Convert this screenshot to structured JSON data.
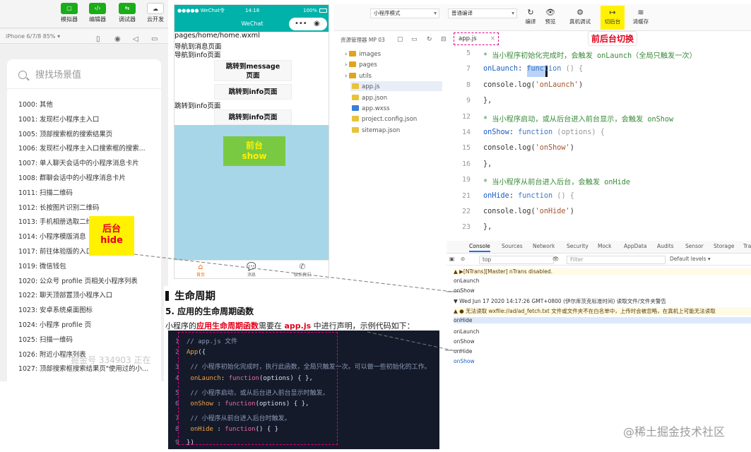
{
  "left": {
    "toolbar": [
      {
        "label": "模拟器",
        "glyph": "▢"
      },
      {
        "label": "编辑器",
        "glyph": "‹/›"
      },
      {
        "label": "调试器",
        "glyph": "⇆"
      },
      {
        "label": "云开发",
        "glyph": "☁"
      }
    ],
    "device": "iPhone 6/7/8 85% ▾",
    "search_placeholder": "搜找场景值",
    "scenes": [
      "1000: 其他",
      "1001: 发现栏小程序主入口",
      "1005: 顶部搜索框的搜索结果页",
      "1006: 发现栏小程序主入口搜索框的搜索...",
      "1007: 单人聊天会话中的小程序消息卡片",
      "1008: 群聊会话中的小程序消息卡片",
      "1011: 扫描二维码",
      "1012: 长按图片识别二维码",
      "1013: 手机相册选取二维码",
      "1014: 小程序模版消息",
      "1017: 前往体验版的入口页",
      "1019: 微信钱包",
      "1020: 公众号 profile 页相关小程序列表",
      "1022: 聊天顶部置顶小程序入口",
      "1023: 安卓系统桌面图标",
      "1024: 小程序 profile 页",
      "1025: 扫描一维码",
      "1026: 附近小程序列表",
      "1027: 顶部搜索框搜索结果页\"使用过的小..."
    ],
    "hide_badge": {
      "line1": "后台",
      "line2": "hide"
    },
    "watermark": "掘金号 334903 正在"
  },
  "phone": {
    "status_left": "●●●●● WeChat令",
    "status_time": "14:18",
    "status_right": "100%",
    "nav_title": "WeChat",
    "capsule_dots": "•••",
    "capsule_target": "◉",
    "path": "pages/home/home.wxml",
    "link1": "导航到消息页面",
    "link2": "导航到info页面",
    "btn_message": "跳转到message页面",
    "btn_info1": "跳转到info页面",
    "link3": "跳转到info页面",
    "btn_info2": "跳转到info页面",
    "show_badge": {
      "line1": "前台",
      "line2": "show"
    },
    "tabs": [
      {
        "label": "首页",
        "glyph": "⌂"
      },
      {
        "label": "消息",
        "glyph": "💬"
      },
      {
        "label": "联系我们",
        "glyph": "✆"
      }
    ]
  },
  "ide": {
    "mode_select": "小程序模式",
    "compile_select": "普通编译",
    "tools": [
      {
        "label": "编译",
        "glyph": "↻"
      },
      {
        "label": "预览",
        "glyph": "👁"
      },
      {
        "label": "真机调试",
        "glyph": "⚙"
      },
      {
        "label": "切后台",
        "glyph": "↦"
      },
      {
        "label": "清缓存",
        "glyph": "≋"
      }
    ],
    "explorer_title": "资源管理器  MP 03",
    "tree": [
      {
        "name": "images",
        "kind": "folder"
      },
      {
        "name": "pages",
        "kind": "folder"
      },
      {
        "name": "utils",
        "kind": "folder"
      },
      {
        "name": "app.js",
        "kind": "js"
      },
      {
        "name": "app.json",
        "kind": "json"
      },
      {
        "name": "app.wxss",
        "kind": "wxss"
      },
      {
        "name": "project.config.json",
        "kind": "json"
      },
      {
        "name": "sitemap.json",
        "kind": "json"
      }
    ],
    "editor_tab": "app.js",
    "switch_label": "前后台切换",
    "code_lines": [
      {
        "n": "5",
        "comment": " * 当小程序初始化完成时，会触发 onLaunch（全局只触发一次）"
      },
      {
        "n": "7",
        "fn": "onLaunch",
        "mid": ": ",
        "kw": "function",
        "rest": " () {"
      },
      {
        "n": "8",
        "plain": "  console.log(",
        "str": "'onLaunch'",
        "tail": ")"
      },
      {
        "n": "9",
        "plain": "},"
      },
      {
        "n": "12",
        "comment": " * 当小程序启动，或从后台进入前台显示，会触发 onShow"
      },
      {
        "n": "14",
        "fn": "onShow",
        "mid": ": ",
        "kw": "function",
        "rest": " (options) {"
      },
      {
        "n": "15",
        "plain": "  console.log(",
        "str": "'onShow'",
        "tail": ")"
      },
      {
        "n": "16",
        "plain": "},"
      },
      {
        "n": "19",
        "comment": " * 当小程序从前台进入后台，会触发 onHide"
      },
      {
        "n": "21",
        "fn": "onHide",
        "mid": ": ",
        "kw": "function",
        "rest": " () {"
      },
      {
        "n": "22",
        "plain": "  console.log(",
        "str": "'onHide'",
        "tail": ")"
      },
      {
        "n": "23",
        "plain": "},"
      }
    ],
    "console_tabs": [
      "Console",
      "Sources",
      "Network",
      "Security",
      "Mock",
      "AppData",
      "Audits",
      "Sensor",
      "Storage",
      "Tra"
    ],
    "console_context": "top",
    "console_filter": "Filter",
    "console_levels": "Default levels ▾",
    "console_lines": [
      {
        "text": "▲ ▶[NTrans][Master] nTrans disabled.",
        "kind": "warn"
      },
      {
        "text": "onLaunch",
        "kind": "plain"
      },
      {
        "text": "onShow",
        "kind": "plain"
      },
      {
        "text": "▼ Wed Jun 17 2020 14:17:26 GMT+0800 (伊尔库茨克标准时间) 读取文件/文件夹警告",
        "kind": "plain"
      },
      {
        "text": "▲ ● 无法读取 wxfile://ad/ad_fetch.txt 文件或文件夹不在白名单中，上传时会被忽略，在真机上可能无法读取",
        "kind": "warn"
      },
      {
        "text": "onHide",
        "kind": "sel"
      },
      {
        "text": "onLaunch",
        "kind": "plain"
      },
      {
        "text": "onShow",
        "kind": "plain"
      },
      {
        "text": "onHide",
        "kind": "plain"
      },
      {
        "text": "onShow",
        "kind": "blue"
      }
    ]
  },
  "article": {
    "h1": "生命周期",
    "h2": "5. 应用的生命周期函数",
    "p_a": "小程序的",
    "p_red": "应用生命周期函数",
    "p_b": "需要在 ",
    "p_red2": "app.js",
    "p_c": " 中进行声明，示例代码如下：",
    "code": [
      {
        "n": "1",
        "c": "// app.js 文件"
      },
      {
        "n": "2",
        "or": "App",
        "bl": "({"
      },
      {
        "n": "3",
        "c": "  // 小程序初始化完成时，执行此函数，全局只触发一次。可以做一些初始化的工作。"
      },
      {
        "n": "4",
        "or": "  onLaunch",
        "bl": ": ",
        "pk": "function",
        "rest": "(options) { },"
      },
      {
        "n": "5",
        "c": "  // 小程序启动，或从后台进入前台显示时触发。"
      },
      {
        "n": "6",
        "or": "  onShow",
        "bl": "  : ",
        "pk": "function",
        "rest": "(options) { },"
      },
      {
        "n": "7",
        "c": "  // 小程序从前台进入后台时触发。"
      },
      {
        "n": "8",
        "or": "  onHide",
        "bl": "  : ",
        "pk": "function",
        "rest": "() { }"
      },
      {
        "n": "9",
        "bl": "})"
      }
    ]
  },
  "footer_watermark": "@稀土掘金技术社区",
  "colors": {
    "teal": "#00b2aa",
    "highlight_yellow": "#fff100",
    "red": "#e2001a",
    "green": "#7ac943",
    "magenta_dash": "#e0008a",
    "code_bg": "#141a29"
  }
}
